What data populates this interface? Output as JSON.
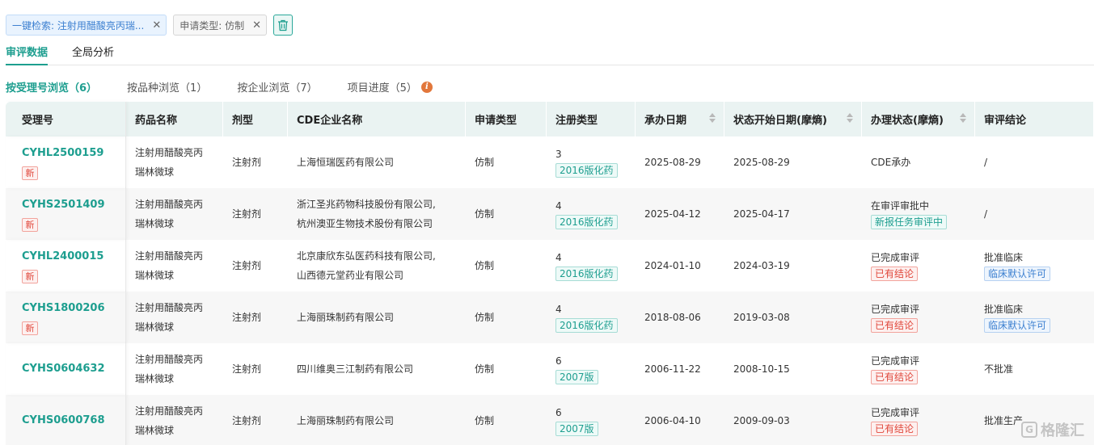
{
  "filters": {
    "chips": [
      {
        "label": "一键检索: 注射用醋酸亮丙瑞..."
      },
      {
        "label": "申请类型: 仿制"
      }
    ],
    "clear_icon": "trash-icon"
  },
  "top_tabs": [
    "审评数据",
    "全局分析"
  ],
  "sub_tabs": [
    {
      "label": "按受理号浏览（6）"
    },
    {
      "label": "按品种浏览（1）"
    },
    {
      "label": "按企业浏览（7）"
    },
    {
      "label": "项目进度（5）"
    }
  ],
  "info_icon_glyph": "i",
  "table": {
    "headers": [
      "受理号",
      "药品名称",
      "剂型",
      "CDE企业名称",
      "申请类型",
      "注册类型",
      "承办日期",
      "状态开始日期(摩熵)",
      "办理状态(摩熵)",
      "审评结论"
    ],
    "rows": [
      {
        "acceptance_no": "CYHL2500159",
        "is_new": true,
        "new_label": "新",
        "drug_line1": "注射用醋酸亮丙",
        "drug_line2": "瑞林微球",
        "dosage_form": "注射剂",
        "company_line1": "上海恒瑞医药有限公司",
        "company_line2": "",
        "app_type": "仿制",
        "reg_num": "3",
        "reg_tag": "2016版化药",
        "accept_date": "2025-08-29",
        "status_date": "2025-08-29",
        "status": "CDE承办",
        "status_tag": "",
        "status_tag_color": "",
        "conclusion": "/",
        "conclusion_tag": ""
      },
      {
        "acceptance_no": "CYHS2501409",
        "is_new": true,
        "new_label": "新",
        "drug_line1": "注射用醋酸亮丙",
        "drug_line2": "瑞林微球",
        "dosage_form": "注射剂",
        "company_line1": "浙江圣兆药物科技股份有限公司,",
        "company_line2": "杭州澳亚生物技术股份有限公司",
        "app_type": "仿制",
        "reg_num": "4",
        "reg_tag": "2016版化药",
        "accept_date": "2025-04-12",
        "status_date": "2025-04-17",
        "status": "在审评审批中",
        "status_tag": "新报任务审评中",
        "status_tag_color": "green",
        "conclusion": "/",
        "conclusion_tag": ""
      },
      {
        "acceptance_no": "CYHL2400015",
        "is_new": true,
        "new_label": "新",
        "drug_line1": "注射用醋酸亮丙",
        "drug_line2": "瑞林微球",
        "dosage_form": "注射剂",
        "company_line1": "北京康欣东弘医药科技有限公司,",
        "company_line2": "山西德元堂药业有限公司",
        "app_type": "仿制",
        "reg_num": "4",
        "reg_tag": "2016版化药",
        "accept_date": "2024-01-10",
        "status_date": "2024-03-19",
        "status": "已完成审评",
        "status_tag": "已有结论",
        "status_tag_color": "red",
        "conclusion": "批准临床",
        "conclusion_tag": "临床默认许可"
      },
      {
        "acceptance_no": "CYHS1800206",
        "is_new": true,
        "new_label": "新",
        "drug_line1": "注射用醋酸亮丙",
        "drug_line2": "瑞林微球",
        "dosage_form": "注射剂",
        "company_line1": "上海丽珠制药有限公司",
        "company_line2": "",
        "app_type": "仿制",
        "reg_num": "4",
        "reg_tag": "2016版化药",
        "accept_date": "2018-08-06",
        "status_date": "2019-03-08",
        "status": "已完成审评",
        "status_tag": "已有结论",
        "status_tag_color": "red",
        "conclusion": "批准临床",
        "conclusion_tag": "临床默认许可"
      },
      {
        "acceptance_no": "CYHS0604632",
        "is_new": false,
        "new_label": "",
        "drug_line1": "注射用醋酸亮丙",
        "drug_line2": "瑞林微球",
        "dosage_form": "注射剂",
        "company_line1": "四川维奥三江制药有限公司",
        "company_line2": "",
        "app_type": "仿制",
        "reg_num": "6",
        "reg_tag": "2007版",
        "accept_date": "2006-11-22",
        "status_date": "2008-10-15",
        "status": "已完成审评",
        "status_tag": "已有结论",
        "status_tag_color": "red",
        "conclusion": "不批准",
        "conclusion_tag": ""
      },
      {
        "acceptance_no": "CYHS0600768",
        "is_new": false,
        "new_label": "",
        "drug_line1": "注射用醋酸亮丙",
        "drug_line2": "瑞林微球",
        "dosage_form": "注射剂",
        "company_line1": "上海丽珠制药有限公司",
        "company_line2": "",
        "app_type": "仿制",
        "reg_num": "6",
        "reg_tag": "2007版",
        "accept_date": "2006-04-10",
        "status_date": "2009-09-03",
        "status": "已完成审评",
        "status_tag": "已有结论",
        "status_tag_color": "red",
        "conclusion": "批准生产",
        "conclusion_tag": ""
      }
    ]
  },
  "watermark": {
    "text": "格隆汇",
    "logo_glyph": "G"
  },
  "colors": {
    "accent": "#1d9e8f",
    "header_bg": "#eaf3f2",
    "new_red": "#e0463a",
    "link_blue": "#3b7fd0"
  }
}
